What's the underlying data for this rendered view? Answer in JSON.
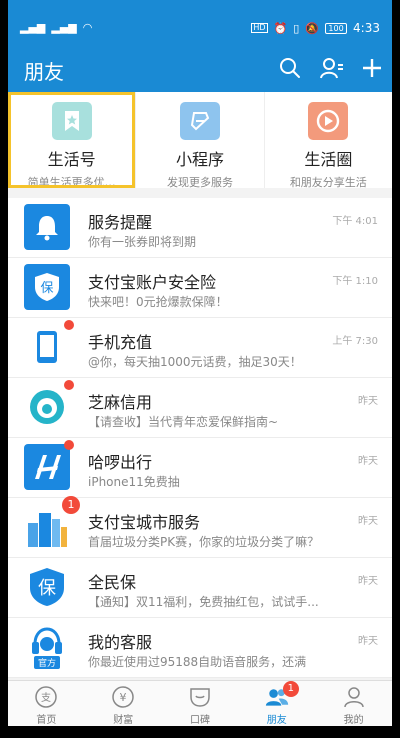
{
  "status_bar": {
    "time": "4:33",
    "battery": "100",
    "hd": "HD"
  },
  "header": {
    "title": "朋友"
  },
  "quick_actions": [
    {
      "title": "生活号",
      "subtitle": "简单生活更多优…"
    },
    {
      "title": "小程序",
      "subtitle": "发现更多服务"
    },
    {
      "title": "生活圈",
      "subtitle": "和朋友分享生活"
    }
  ],
  "list": [
    {
      "title": "服务提醒",
      "subtitle": "你有一张券即将到期",
      "time": "下午 4:01"
    },
    {
      "title": "支付宝账户安全险",
      "subtitle": "快来吧！0元抢爆款保障！",
      "time": "下午 1:10"
    },
    {
      "title": "手机充值",
      "subtitle": "@你，每天抽1000元话费，抽足30天！",
      "time": "上午 7:30"
    },
    {
      "title": "芝麻信用",
      "subtitle": "【请查收】当代青年恋爱保鲜指南~",
      "time": "昨天"
    },
    {
      "title": "哈啰出行",
      "subtitle": "iPhone11免费抽",
      "time": "昨天"
    },
    {
      "title": "支付宝城市服务",
      "subtitle": "首届垃圾分类PK赛，你家的垃圾分类了嘛？",
      "time": "昨天",
      "badge": "1"
    },
    {
      "title": "全民保",
      "subtitle": "【通知】双11福利，免费抽红包，试试手...",
      "time": "昨天"
    },
    {
      "title": "我的客服",
      "subtitle": "你最近使用过95188自助语音服务，还满",
      "time": "昨天",
      "tag": "官方"
    }
  ],
  "tabs": [
    {
      "label": "首页"
    },
    {
      "label": "财富"
    },
    {
      "label": "口碑"
    },
    {
      "label": "朋友",
      "badge": "1"
    },
    {
      "label": "我的"
    }
  ],
  "colors": {
    "brand": "#1a8ad4",
    "badge": "#f24a3a",
    "highlight": "#f5c32b"
  }
}
